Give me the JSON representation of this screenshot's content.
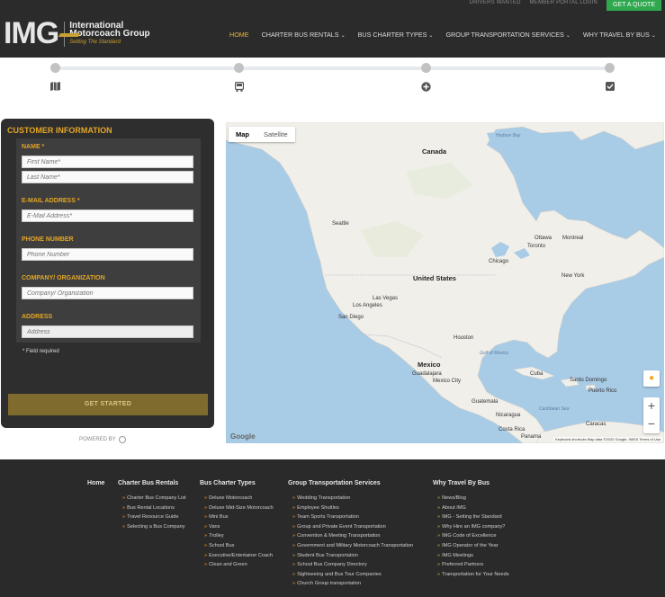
{
  "topbar": {
    "drivers_wanted": "DRIVERS WANTED",
    "member_portal": "MEMBER PORTAL LOGIN",
    "quote_button": "GET A QUOTE"
  },
  "logo": {
    "mark": "IMG",
    "line1": "International",
    "line2": "Motorcoach Group",
    "tagline": "Setting The Standard"
  },
  "nav": {
    "items": [
      {
        "label": "HOME",
        "dropdown": ""
      },
      {
        "label": "CHARTER BUS RENTALS",
        "dropdown": "⌄"
      },
      {
        "label": "BUS CHARTER TYPES",
        "dropdown": "⌄"
      },
      {
        "label": "GROUP TRANSPORTATION SERVICES",
        "dropdown": "⌄"
      },
      {
        "label": "WHY TRAVEL BY BUS",
        "dropdown": "⌄"
      }
    ]
  },
  "steps": {
    "icons": [
      "map-icon",
      "bus-icon",
      "plus-circle-icon",
      "checkbox-icon"
    ]
  },
  "form": {
    "title": "CUSTOMER INFORMATION",
    "name_label": "NAME *",
    "first_name_placeholder": "First Name*",
    "last_name_placeholder": "Last Name*",
    "email_label": "E-MAIL ADDRESS *",
    "email_placeholder": "E-Mail Address*",
    "phone_label": "PHONE NUMBER",
    "phone_placeholder": "Phone Number",
    "company_label": "COMPANY/ ORGANIZATION",
    "company_placeholder": "Company/ Organization",
    "address_label": "ADDRESS",
    "address_placeholder": "Address",
    "required_note": "* Field required",
    "submit_label": "GET STARTED",
    "powered_by": "POWERED BY"
  },
  "map": {
    "tab_map": "Map",
    "tab_satellite": "Satellite",
    "labels": {
      "canada": "Canada",
      "united_states": "United States",
      "mexico": "Mexico",
      "hudson_bay": "Hudson Bay",
      "seattle": "Seattle",
      "chicago": "Chicago",
      "toronto": "Toronto",
      "ottawa": "Ottawa",
      "montreal": "Montreal",
      "new_york": "New York",
      "las_vegas": "Las Vegas",
      "los_angeles": "Los Angeles",
      "san_diego": "San Diego",
      "houston": "Houston",
      "gulf_of_mexico": "Gulf of Mexico",
      "guadalajara": "Guadalajara",
      "mexico_city": "Mexico City",
      "cuba": "Cuba",
      "santo_domingo": "Santo Domingo",
      "puerto_rico": "Puerto Rico",
      "guatemala": "Guatemala",
      "caribbean_sea": "Caribbean Sea",
      "nicaragua": "Nicaragua",
      "costa_rica": "Costa Rica",
      "panama": "Panama",
      "caracas": "Caracas"
    },
    "google": "Google",
    "attribution": "Keyboard shortcuts   Map data ©2022 Google, INEGI   Terms of Use"
  },
  "footer": {
    "home": "Home",
    "columns": [
      {
        "heading": "Charter Bus Rentals",
        "links": [
          "Charter Bus Company List",
          "Bus Rental Locations",
          "Travel Resource Guide",
          "Selecting a Bus Company"
        ]
      },
      {
        "heading": "Bus Charter Types",
        "links": [
          "Deluxe Motorcoach",
          "Deluxe Mid-Size Motorcoach",
          "Mini Bus",
          "Vans",
          "Trolley",
          "School Bus",
          "Executive/Entertainer Coach",
          "Clean and Green"
        ]
      },
      {
        "heading": "Group Transportation Services",
        "links": [
          "Wedding Transportation",
          "Employee Shuttles",
          "Team Sports Transportation",
          "Group and Private Event Transportation",
          "Convention & Meeting Transportation",
          "Government and Military Motorcoach Transportation",
          "Student Bus Transportation",
          "School Bus Company Directory",
          "Sightseeing and Bus Tour Companies",
          "Church Group transportation"
        ]
      },
      {
        "heading": "Why Travel By Bus",
        "links": [
          "News/Blog",
          "About IMG",
          "IMG - Setting the Standard",
          "Why Hire an IMG company?",
          "IMG Code of Excellence",
          "IMG Operator of the Year",
          "IMG Meetings",
          "Preferred Partners",
          "Transportation for Your Needs"
        ]
      }
    ]
  },
  "colors": {
    "accent_gold": "#e3a625",
    "quote_green": "#2fa84f",
    "header_bg": "#2b2b2b",
    "panel_bg": "#2e2e2e"
  }
}
